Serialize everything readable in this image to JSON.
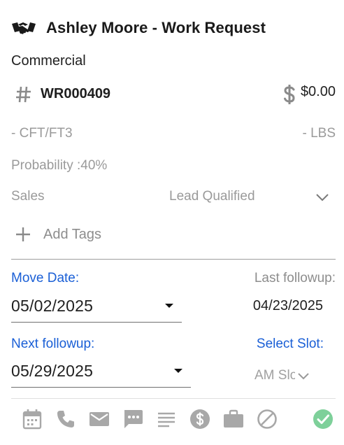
{
  "header": {
    "icon": "handshake-icon",
    "title": "Ashley Moore - Work Request"
  },
  "job": {
    "type": "Commercial",
    "number_icon": "hash-icon",
    "number": "WR000409",
    "amount_icon": "dollar-icon",
    "amount": "$0.00",
    "volume": "- CFT/FT3",
    "weight": "- LBS",
    "probability": "Probability :40%"
  },
  "stage": {
    "pipeline": "Sales",
    "status": "Lead Qualified",
    "status_icon": "chevron-down-icon"
  },
  "tags": {
    "icon": "plus-icon",
    "label": "Add Tags"
  },
  "move_date": {
    "label": "Move Date:",
    "value": "05/02/2025"
  },
  "last_followup": {
    "label": "Last followup:",
    "value": "04/23/2025"
  },
  "next_followup": {
    "label": "Next followup:",
    "value": "05/29/2025"
  },
  "slot": {
    "label": "Select Slot:",
    "value": "AM Slot"
  },
  "toolbar": {
    "icons": [
      "calendar-icon",
      "phone-icon",
      "email-icon",
      "message-icon",
      "notes-icon",
      "dollar-circle-icon",
      "briefcase-icon",
      "block-icon",
      "check-circle-icon"
    ]
  },
  "colors": {
    "accent_blue": "#1a5fd6",
    "muted_text": "#9a9a9a",
    "icon_gray": "#a8a8a8",
    "success_green": "#7ed09a"
  }
}
